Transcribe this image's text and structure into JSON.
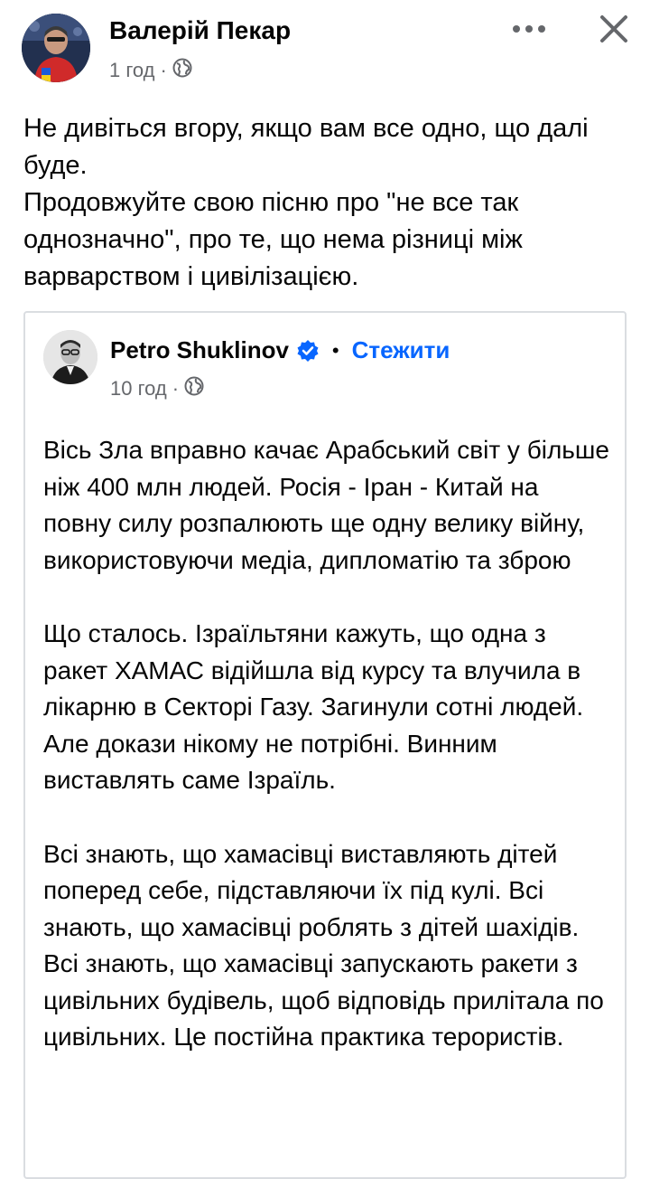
{
  "post": {
    "author": "Валерій Пекар",
    "time": "1 год",
    "dot": "·",
    "lines": [
      "Не дивіться вгору, якщо вам все одно, що далі буде.",
      "Продовжуйте свою пісню про \"не все так однозначно\", про те, що нема різниці між варварством і цивілізацією."
    ]
  },
  "shared": {
    "author": "Petro Shuklinov",
    "separator": "•",
    "follow_label": "Стежити",
    "time": "10 год",
    "dot": "·",
    "paragraphs": [
      "Вісь Зла вправно качає Арабський світ у більше ніж 400 млн людей. Росія - Іран - Китай на повну силу розпалюють ще одну велику війну, використовуючи медіа, дипломатію та зброю",
      "Що сталось. Ізраїльтяни кажуть, що одна з ракет ХАМАС відійшла від курсу та влучила в лікарню в Секторі Газу. Загинули сотні людей. Але докази нікому не потрібні. Винним виставлять саме Ізраїль.",
      "Всі знають, що хамасівці виставляють дітей поперед себе, підставляючи їх під кулі. Всі знають, що хамасівці роблять з дітей шахідів. Всі знають, що хамасівці запускають ракети з цивільних будівель, щоб відповідь прилітала по цивільних. Це постійна практика терористів."
    ]
  },
  "icons": {
    "more": "more-horizontal-icon",
    "close": "close-icon",
    "privacy": "globe-icon",
    "verified": "verified-badge-icon"
  },
  "colors": {
    "accent": "#0866ff",
    "meta_text": "#65676b",
    "card_border": "#dadde1"
  }
}
